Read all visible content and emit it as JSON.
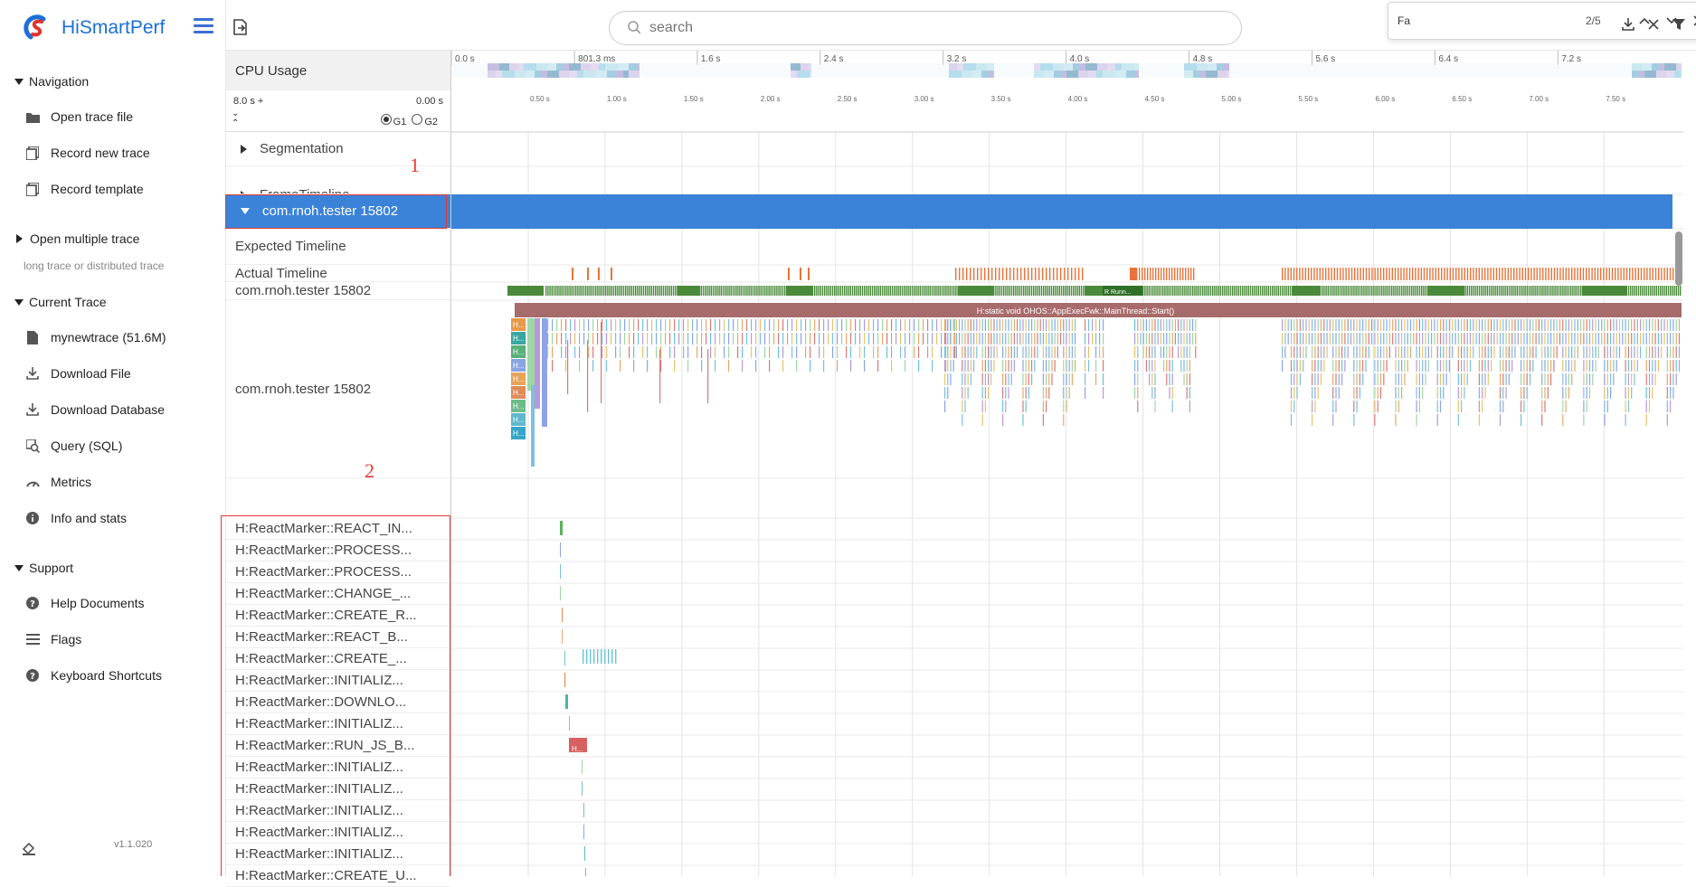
{
  "app": {
    "name": "HiSmartPerf",
    "version": "v1.1.020"
  },
  "search": {
    "placeholder": "search"
  },
  "find": {
    "query": "Fa",
    "count": "2/5"
  },
  "sidebar": {
    "navigation": {
      "title": "Navigation",
      "items": [
        {
          "label": "Open trace file",
          "icon": "folder-icon"
        },
        {
          "label": "Record new trace",
          "icon": "copy-icon"
        },
        {
          "label": "Record template",
          "icon": "copy-icon"
        }
      ]
    },
    "multi": {
      "title": "Open multiple trace",
      "sub": "long trace or distributed trace"
    },
    "current": {
      "title": "Current Trace",
      "items": [
        {
          "label": "mynewtrace (51.6M)",
          "icon": "file-icon"
        },
        {
          "label": "Download File",
          "icon": "download-icon"
        },
        {
          "label": "Download Database",
          "icon": "download-icon"
        },
        {
          "label": "Query (SQL)",
          "icon": "query-icon"
        },
        {
          "label": "Metrics",
          "icon": "gauge-icon"
        },
        {
          "label": "Info and stats",
          "icon": "info-icon"
        }
      ]
    },
    "support": {
      "title": "Support",
      "items": [
        {
          "label": "Help Documents",
          "icon": "help-icon"
        },
        {
          "label": "Flags",
          "icon": "flags-icon"
        },
        {
          "label": "Keyboard Shortcuts",
          "icon": "help-icon"
        }
      ]
    }
  },
  "timeline": {
    "cpu_label": "CPU Usage",
    "range_total": "8.0 s +",
    "range_start": "0.00 s",
    "radio_g1": "G1",
    "radio_g2": "G2",
    "top_ticks": [
      "0.0 s",
      "801.3 ms",
      "1.6 s",
      "2.4 s",
      "3.2 s",
      "4.0 s",
      "4.8 s",
      "5.6 s",
      "6.4 s",
      "7.2 s"
    ],
    "sub_ticks": [
      "0.50 s",
      "1.00 s",
      "1.50 s",
      "2.00 s",
      "2.50 s",
      "3.00 s",
      "3.50 s",
      "4.00 s",
      "4.50 s",
      "5.00 s",
      "5.50 s",
      "6.00 s",
      "6.50 s",
      "7.00 s",
      "7.50 s"
    ],
    "rows": {
      "segmentation": "Segmentation",
      "frame_timeline": "FrameTimeline",
      "process": "com.rnoh.tester 15802",
      "expected": "Expected Timeline",
      "actual": "Actual Timeline",
      "thread": "com.rnoh.tester 15802",
      "thread_main": "com.rnoh.tester 15802"
    },
    "main_slice": "H:static void OHOS::AppExecFwk::MainThread::Start()",
    "running_tag": "R  Runn...",
    "slice_small": "H...",
    "markers": [
      "H:ReactMarker::REACT_IN...",
      "H:ReactMarker::PROCESS...",
      "H:ReactMarker::PROCESS...",
      "H:ReactMarker::CHANGE_...",
      "H:ReactMarker::CREATE_R...",
      "H:ReactMarker::REACT_B...",
      "H:ReactMarker::CREATE_...",
      "H:ReactMarker::INITIALIZ...",
      "H:ReactMarker::DOWNLO...",
      "H:ReactMarker::INITIALIZ...",
      "H:ReactMarker::RUN_JS_B...",
      "H:ReactMarker::INITIALIZ...",
      "H:ReactMarker::INITIALIZ...",
      "H:ReactMarker::INITIALIZ...",
      "H:ReactMarker::INITIALIZ...",
      "H:ReactMarker::INITIALIZ...",
      "H:ReactMarker::CREATE_U..."
    ]
  },
  "annotations": {
    "a1": "1",
    "a2": "2"
  },
  "colors": {
    "accent": "#3b83d9",
    "brand": "#1b6fd6",
    "annotation": "#e53935",
    "thread_green": "#4a8a3a",
    "actual_orange": "#e8743b",
    "main_slice": "#a86b6b"
  }
}
